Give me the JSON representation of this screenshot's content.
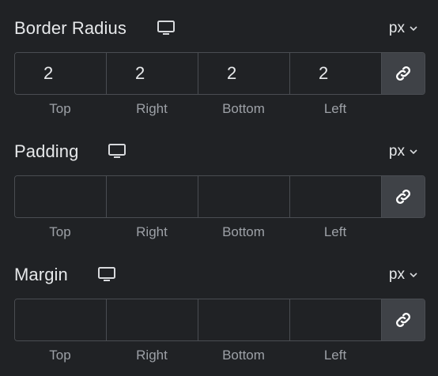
{
  "controls": [
    {
      "title": "Border Radius",
      "device_icon": "desktop-icon",
      "unit": "px",
      "values": [
        "2",
        "2",
        "2",
        "2"
      ],
      "link_icon": "link-icon",
      "labels": [
        "Top",
        "Right",
        "Bottom",
        "Left"
      ]
    },
    {
      "title": "Padding",
      "device_icon": "desktop-icon",
      "unit": "px",
      "values": [
        "",
        "",
        "",
        ""
      ],
      "link_icon": "link-icon",
      "labels": [
        "Top",
        "Right",
        "Bottom",
        "Left"
      ]
    },
    {
      "title": "Margin",
      "device_icon": "desktop-icon",
      "unit": "px",
      "values": [
        "",
        "",
        "",
        ""
      ],
      "link_icon": "link-icon",
      "labels": [
        "Top",
        "Right",
        "Bottom",
        "Left"
      ]
    }
  ]
}
